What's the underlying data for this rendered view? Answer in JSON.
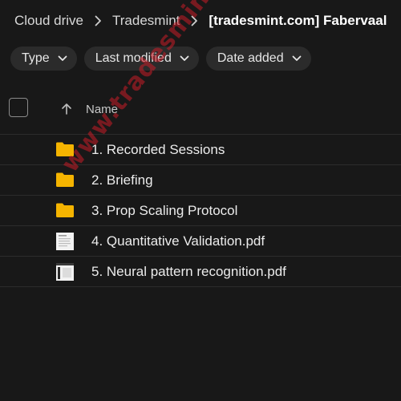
{
  "breadcrumb": {
    "items": [
      {
        "label": "Cloud drive"
      },
      {
        "label": "Tradesmint"
      },
      {
        "label": "[tradesmint.com] Fabervaal"
      }
    ]
  },
  "filters": [
    {
      "label": "Type"
    },
    {
      "label": "Last modified"
    },
    {
      "label": "Date added"
    }
  ],
  "table": {
    "header": {
      "name_label": "Name",
      "sort_direction": "ascending"
    },
    "rows": [
      {
        "label": "1. Recorded Sessions",
        "icon": "folder-icon"
      },
      {
        "label": "2. Briefing",
        "icon": "folder-icon"
      },
      {
        "label": "3. Prop Scaling Protocol",
        "icon": "folder-icon"
      },
      {
        "label": "4. Quantitative Validation.pdf",
        "icon": "pdf-thumbnail-icon"
      },
      {
        "label": "5. Neural pattern recognition.pdf",
        "icon": "pdf-thumbnail-icon"
      }
    ]
  },
  "watermark": {
    "text": "www.tradesmint.com"
  },
  "colors": {
    "background": "#181818",
    "chip_background": "#2b2b2b",
    "folder": "#f5b400",
    "watermark": "#c81e28",
    "divider": "#2c2c2c"
  }
}
